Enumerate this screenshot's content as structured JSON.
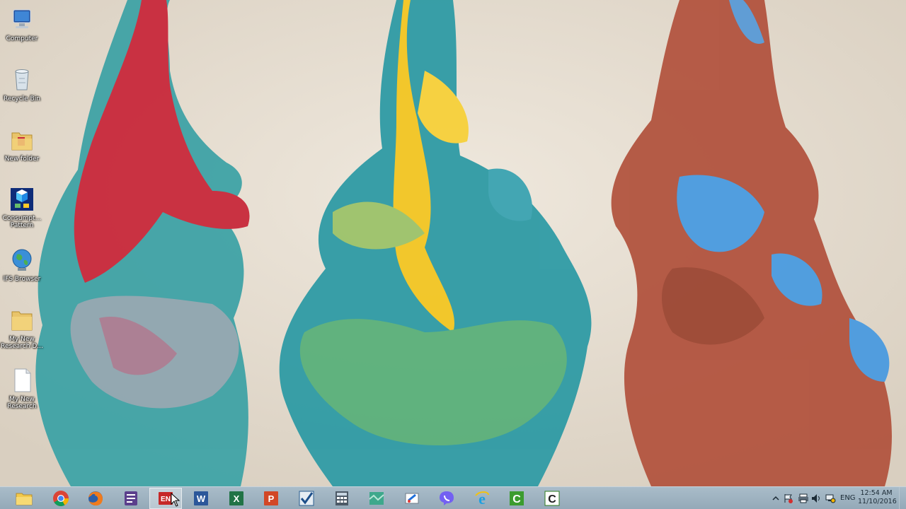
{
  "desktop": {
    "icons": [
      {
        "label": "Computer",
        "icon": "computer-icon"
      },
      {
        "label": "Recycle Bin",
        "icon": "recycle-bin-icon"
      },
      {
        "label": "New folder",
        "icon": "folder-icon"
      },
      {
        "label": "Consumpt... Pattern",
        "icon": "app-icon"
      },
      {
        "label": "IFS Browser",
        "icon": "globe-icon"
      },
      {
        "label": "My New Research D...",
        "icon": "folder-icon"
      },
      {
        "label": "My New Research",
        "icon": "document-icon"
      }
    ]
  },
  "taskbar": {
    "buttons": [
      {
        "name": "file-explorer",
        "icon": "folder-icon"
      },
      {
        "name": "google-chrome",
        "icon": "chrome-icon"
      },
      {
        "name": "firefox",
        "icon": "firefox-icon"
      },
      {
        "name": "app-purple",
        "icon": "app-icon"
      },
      {
        "name": "endnote",
        "icon": "endnote-icon",
        "text": "EN"
      },
      {
        "name": "word",
        "icon": "word-icon",
        "text": "W"
      },
      {
        "name": "excel",
        "icon": "excel-icon",
        "text": "X"
      },
      {
        "name": "powerpoint",
        "icon": "powerpoint-icon",
        "text": "P"
      },
      {
        "name": "task-app",
        "icon": "checkmark-icon"
      },
      {
        "name": "calculator",
        "icon": "calculator-icon"
      },
      {
        "name": "maps",
        "icon": "map-icon"
      },
      {
        "name": "paint",
        "icon": "paint-icon"
      },
      {
        "name": "viber",
        "icon": "viber-icon"
      },
      {
        "name": "internet-explorer",
        "icon": "ie-icon",
        "text": "e"
      },
      {
        "name": "camtasia-recorder",
        "icon": "camtasia-icon",
        "text": "C"
      },
      {
        "name": "camtasia-studio",
        "icon": "camtasia-icon",
        "text": "C"
      }
    ],
    "tray": {
      "language": "ENG",
      "time": "12:54 AM",
      "date": "11/10/2016"
    }
  },
  "colors": {
    "taskbar": "#a3b6c4",
    "wallpaper_bg": "#e6ddd0"
  }
}
